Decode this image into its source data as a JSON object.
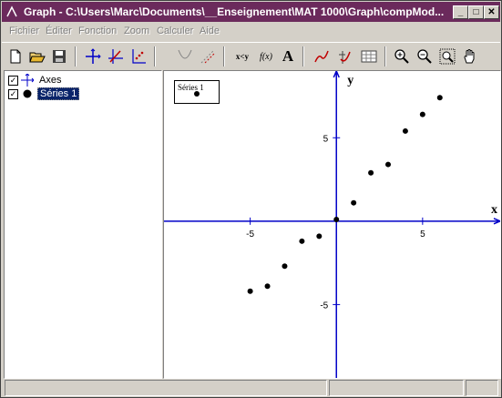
{
  "window": {
    "title": "Graph - C:\\Users\\Marc\\Documents\\__Enseignement\\MAT 1000\\Graph\\compMod..."
  },
  "title_buttons": {
    "minimize": "_",
    "maximize": "□",
    "close": "✕"
  },
  "menu": [
    "Fichier",
    "Éditer",
    "Fonction",
    "Zoom",
    "Calculer",
    "Aide"
  ],
  "toolbar": {
    "icons": [
      "new-file-icon",
      "open-folder-icon",
      "save-icon",
      "axes-icon",
      "insert-label-icon",
      "insert-point-series-icon",
      "tangent-icon",
      "shade-icon",
      "table-xy-icon",
      "function-f-icon",
      "text-icon",
      "trendline-icon",
      "eval-icon",
      "table-icon",
      "zoom-in-icon",
      "zoom-out-icon",
      "zoom-window-icon",
      "hand-icon"
    ],
    "xy_label": "x<y",
    "fx_label": "f(x)",
    "text_label": "A"
  },
  "tree": {
    "items": [
      {
        "label": "Axes",
        "checked": true,
        "check_mark": "✓",
        "icon": "axes-icon",
        "selected": false
      },
      {
        "label": "Séries 1",
        "checked": true,
        "check_mark": "✓",
        "icon": "point-icon",
        "selected": true
      }
    ]
  },
  "chart_data": {
    "type": "scatter",
    "xlabel": "x",
    "ylabel": "y",
    "xlim": [
      -10,
      9.5
    ],
    "ylim": [
      -9.4,
      9.0
    ],
    "x_ticks": [
      -5,
      5
    ],
    "y_ticks": [
      5,
      -5
    ],
    "tick_labels": {
      "x": [
        "-5",
        "5"
      ],
      "y": [
        "5",
        "-5"
      ]
    },
    "legend": {
      "entries": [
        "Séries 1"
      ],
      "placement": "top-left"
    },
    "series": [
      {
        "name": "Séries 1",
        "x": [
          -5,
          -4,
          -3,
          -2,
          -1,
          0,
          1,
          2,
          3,
          4,
          5,
          6
        ],
        "y": [
          -4.2,
          -3.9,
          -2.7,
          -1.2,
          -0.9,
          0.1,
          1.1,
          2.9,
          3.4,
          5.4,
          6.4,
          7.4
        ]
      }
    ],
    "colors": {
      "axes": "#0000c8",
      "points": "#000000"
    }
  },
  "colors": {
    "titlebar": "#6b2a5c",
    "selection": "#0a246a"
  }
}
